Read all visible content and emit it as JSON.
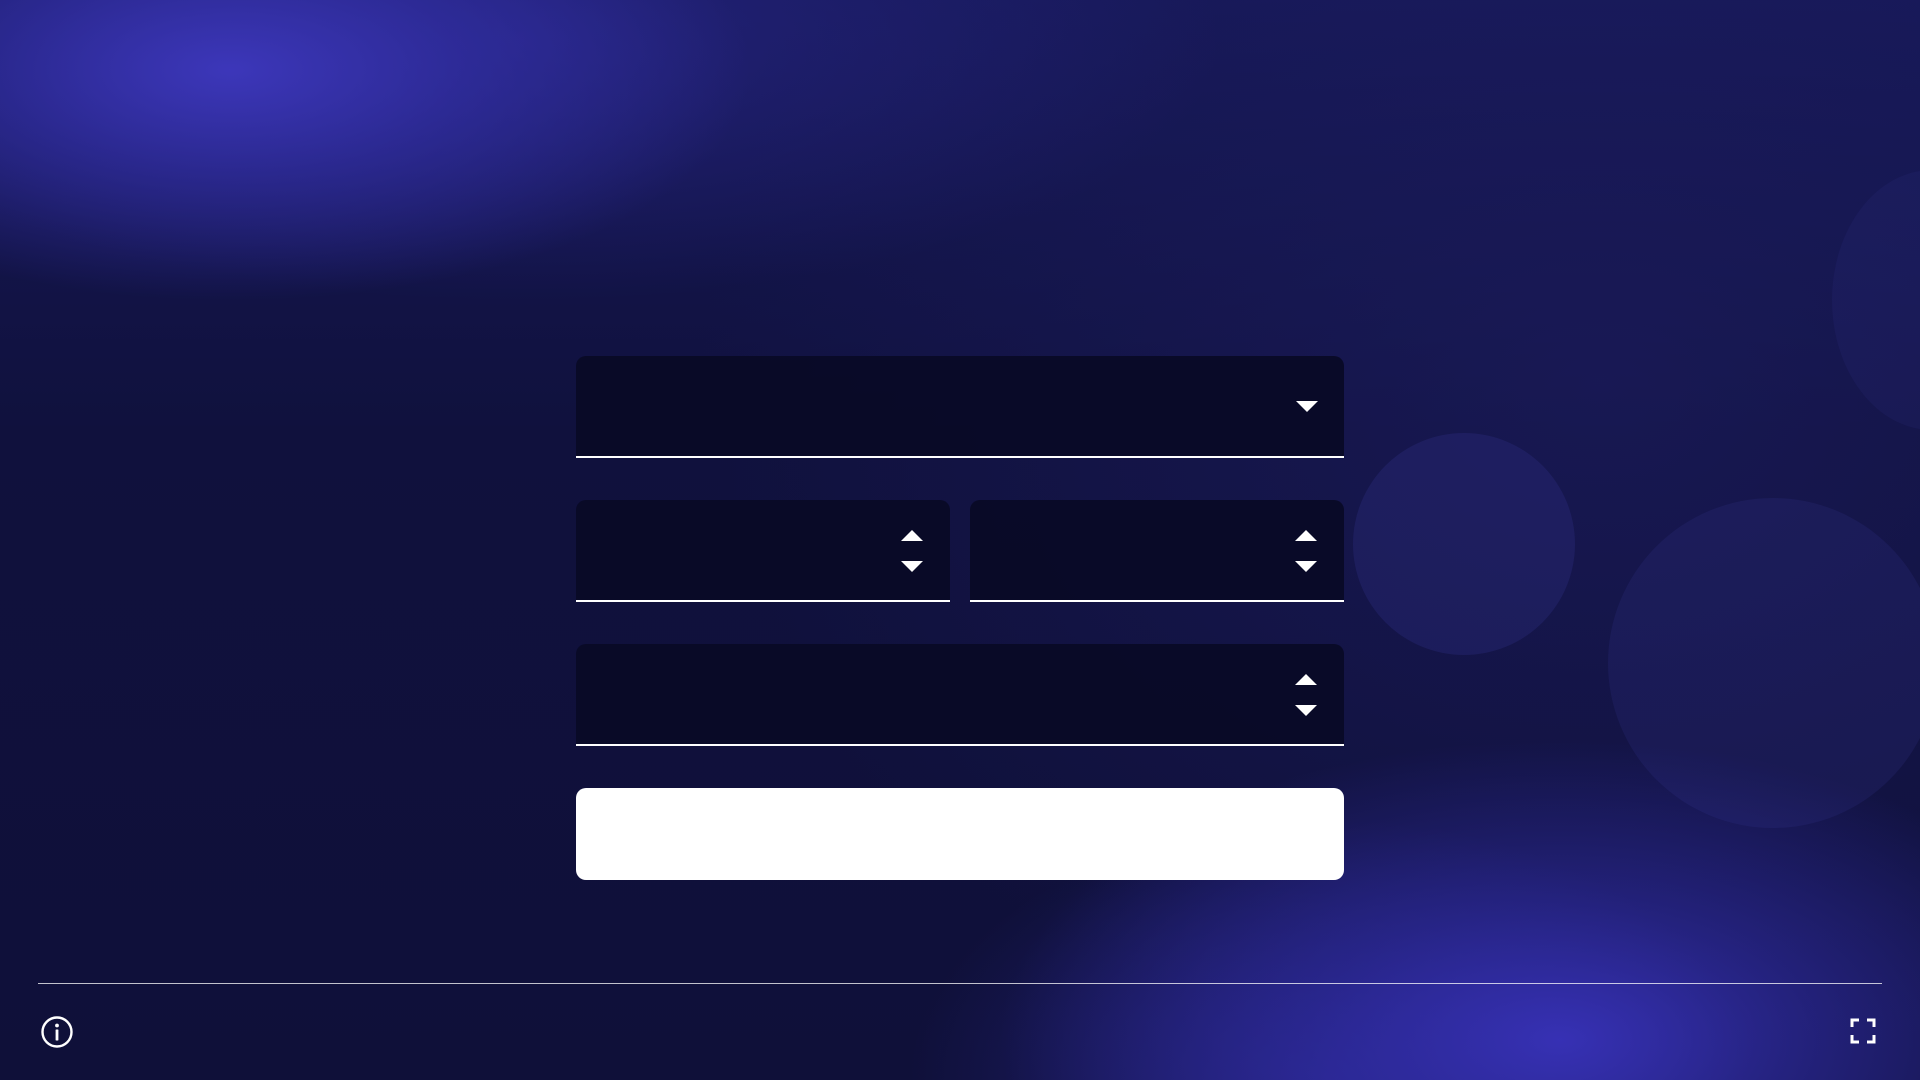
{
  "form": {
    "select_field": {
      "value": "",
      "icon": "chevron-down-icon"
    },
    "number_field_1": {
      "value": "",
      "icons": [
        "chevron-up-icon",
        "chevron-down-icon"
      ]
    },
    "number_field_2": {
      "value": "",
      "icons": [
        "chevron-up-icon",
        "chevron-down-icon"
      ]
    },
    "number_field_3": {
      "value": "",
      "icons": [
        "chevron-up-icon",
        "chevron-down-icon"
      ]
    },
    "submit_button": {
      "label": ""
    }
  },
  "footer": {
    "left_icon": "info-icon",
    "right_icon": "fullscreen-icon"
  },
  "colors": {
    "background": "#11123f",
    "accent_glow": "#3a35b8",
    "field_bg": "#090a26",
    "foreground": "#ffffff"
  }
}
